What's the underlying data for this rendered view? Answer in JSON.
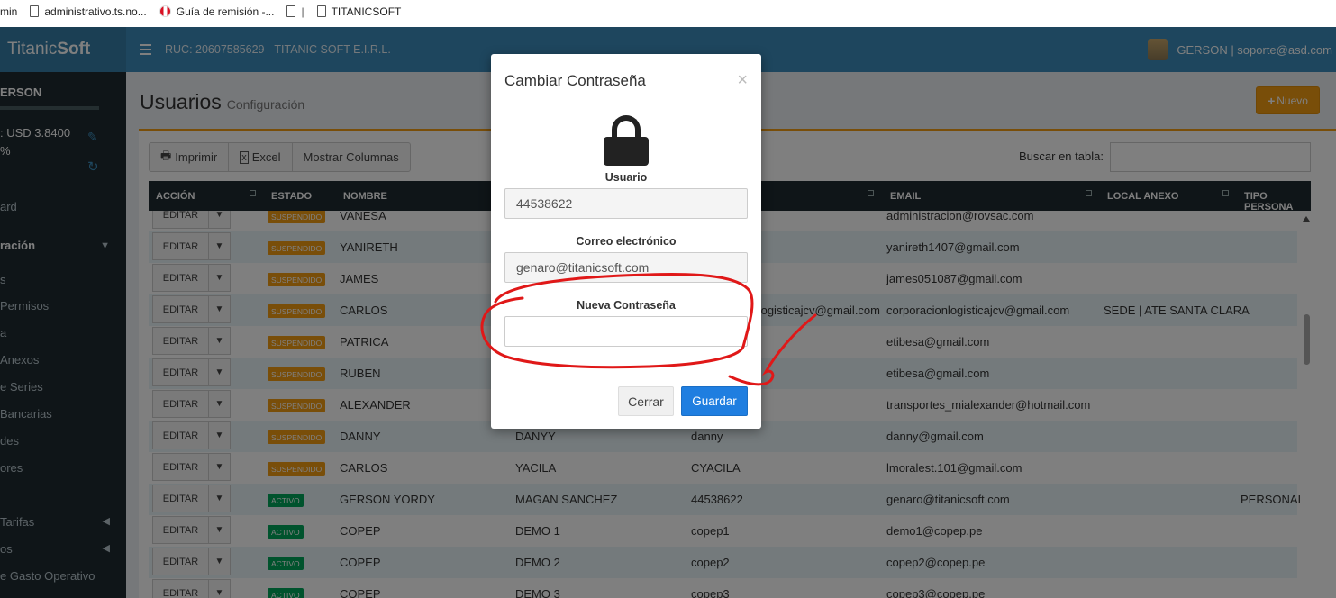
{
  "bookmarks": [
    {
      "label": "min",
      "icon": "none-icon"
    },
    {
      "label": "administrativo.ts.no...",
      "icon": "page-icon"
    },
    {
      "label": "Guía de remisión -...",
      "icon": "peru-flag-icon"
    },
    {
      "label": "|",
      "icon": "page-icon"
    },
    {
      "label": "TITANICSOFT",
      "icon": "page-icon"
    }
  ],
  "header": {
    "brand_light": "Titanic",
    "brand_bold": "Soft",
    "ruc": "RUC: 20607585629 - TITANIC SOFT E.I.R.L.",
    "user": "GERSON | soporte@asd.com"
  },
  "sidebar": {
    "user": "ERSON",
    "rate": ": USD 3.8400",
    "pct": "%",
    "items": [
      "ard",
      "ración",
      "s",
      "Permisos",
      "a",
      "Anexos",
      "e Series",
      "Bancarias",
      "des",
      "ores",
      "Tarifas",
      "os",
      "e Gasto Operativo"
    ]
  },
  "page": {
    "title": "Usuarios",
    "subtitle": "Configuración",
    "new_button": "Nuevo"
  },
  "toolbar": {
    "print": "Imprimir",
    "excel": "Excel",
    "columns": "Mostrar Columnas",
    "search_label": "Buscar en tabla:"
  },
  "table": {
    "headers": [
      "ACCIÓN",
      "ESTADO",
      "NOMBRE",
      "EMAIL",
      "LOCAL ANEXO",
      "TIPO PERSONA"
    ],
    "edit_label": "EDITAR",
    "rows": [
      {
        "estado": "SUSPENDIDO",
        "nombre": "VANESA",
        "apellido": "",
        "usuario": "",
        "email": "administracion@rovsac.com",
        "local": "",
        "tipo": ""
      },
      {
        "estado": "SUSPENDIDO",
        "nombre": "YANIRETH",
        "apellido": "",
        "usuario": "",
        "email": "yanireth1407@gmail.com",
        "local": "",
        "tipo": ""
      },
      {
        "estado": "SUSPENDIDO",
        "nombre": "JAMES",
        "apellido": "",
        "usuario": "",
        "email": "james051087@gmail.com",
        "local": "",
        "tipo": ""
      },
      {
        "estado": "SUSPENDIDO",
        "nombre": "CARLOS",
        "apellido": "",
        "usuario": "ogisticajcv@gmail.com",
        "email": "corporacionlogisticajcv@gmail.com",
        "local": "SEDE | ATE SANTA CLARA",
        "tipo": ""
      },
      {
        "estado": "SUSPENDIDO",
        "nombre": "PATRICA",
        "apellido": "",
        "usuario": "",
        "email": "etibesa@gmail.com",
        "local": "",
        "tipo": ""
      },
      {
        "estado": "SUSPENDIDO",
        "nombre": "RUBEN",
        "apellido": "",
        "usuario": "",
        "email": "etibesa@gmail.com",
        "local": "",
        "tipo": ""
      },
      {
        "estado": "SUSPENDIDO",
        "nombre": "ALEXANDER",
        "apellido": "",
        "usuario": "",
        "email": "transportes_mialexander@hotmail.com",
        "local": "",
        "tipo": ""
      },
      {
        "estado": "SUSPENDIDO",
        "nombre": "DANNY",
        "apellido": "DANYY",
        "usuario": "danny",
        "email": "danny@gmail.com",
        "local": "",
        "tipo": ""
      },
      {
        "estado": "SUSPENDIDO",
        "nombre": "CARLOS",
        "apellido": "YACILA",
        "usuario": "CYACILA",
        "email": "lmoralest.101@gmail.com",
        "local": "",
        "tipo": ""
      },
      {
        "estado": "ACTIVO",
        "nombre": "GERSON YORDY",
        "apellido": "MAGAN SANCHEZ",
        "usuario": "44538622",
        "email": "genaro@titanicsoft.com",
        "local": "",
        "tipo": "PERSONAL"
      },
      {
        "estado": "ACTIVO",
        "nombre": "COPEP",
        "apellido": "DEMO 1",
        "usuario": "copep1",
        "email": "demo1@copep.pe",
        "local": "",
        "tipo": ""
      },
      {
        "estado": "ACTIVO",
        "nombre": "COPEP",
        "apellido": "DEMO 2",
        "usuario": "copep2",
        "email": "copep2@copep.pe",
        "local": "",
        "tipo": ""
      },
      {
        "estado": "ACTIVO",
        "nombre": "COPEP",
        "apellido": "DEMO 3",
        "usuario": "copep3",
        "email": "copep3@copep.pe",
        "local": "",
        "tipo": ""
      }
    ]
  },
  "modal": {
    "title": "Cambiar Contraseña",
    "close": "×",
    "usuario_label": "Usuario",
    "usuario_value": "44538622",
    "correo_label": "Correo electrónico",
    "correo_value": "genaro@titanicsoft.com",
    "nueva_label": "Nueva Contraseña",
    "nueva_value": "",
    "cancel": "Cerrar",
    "save": "Guardar"
  },
  "colors": {
    "header": "#3c8dbc",
    "sidebar": "#1f2a30",
    "warning": "#f39c12",
    "success": "#00a65a",
    "primary": "#1f7ee0",
    "annotation": "#e01818"
  }
}
